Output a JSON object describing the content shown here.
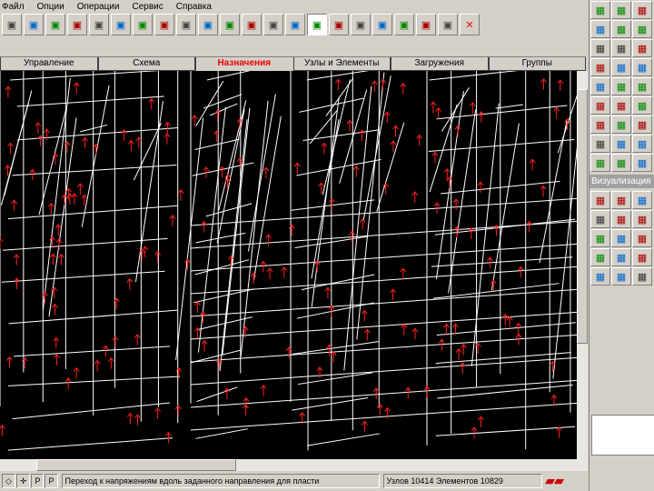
{
  "menu": [
    "Файл",
    "Опции",
    "Операции",
    "Сервис",
    "Справка"
  ],
  "toolbar_icons": [
    "plate-icon",
    "wall-icon",
    "slab-icon",
    "section-icon",
    "support-icon",
    "hinge-icon",
    "node-icon",
    "bar-icon",
    "link-icon",
    "grid-icon",
    "rigid-icon",
    "nodes-icon",
    "local-axes-icon",
    "load-icon",
    "color-map-icon",
    "color-map2-icon",
    "transfer-icon",
    "table-icon",
    "curve-icon",
    "layer-icon",
    "check-icon",
    "delete-icon"
  ],
  "tabs": [
    {
      "label": "Управление"
    },
    {
      "label": "Схема"
    },
    {
      "label": "Назначения",
      "selected": true
    },
    {
      "label": "Узлы и Элементы"
    },
    {
      "label": "Загружения"
    },
    {
      "label": "Группы"
    }
  ],
  "side_icons_top": [
    "pencil-icon",
    "eraser-icon",
    "cube-icon",
    "query-icon",
    "query2-icon",
    "query3-icon",
    "query-t-icon",
    "query-r-icon",
    "beam-icon",
    "axes-icon",
    "axes2-icon",
    "axes3-icon",
    "frame-icon",
    "frame2-icon",
    "frame3-icon",
    "node-num-icon",
    "elem-num-icon",
    "hinge2-icon",
    "flag-icon",
    "weight-icon",
    "list-icon",
    "cut-icon",
    "scale-icon",
    "chart-icon",
    "coords-icon",
    "table2-icon",
    "grid2-icon"
  ],
  "vis_label": "Визуализация",
  "side_icons_bottom": [
    "spin-icon",
    "move-icon",
    "move2-icon",
    "box-icon",
    "box2-icon",
    "box3-icon",
    "frame4-icon",
    "cube2-icon",
    "menu-icon",
    "camera-icon",
    "light-icon",
    "ball-icon",
    "color-icon",
    "grid3-icon",
    "palette-icon"
  ],
  "status": {
    "modes": [
      "◇",
      "✛",
      "P",
      "P"
    ],
    "message": "Переход к напряжениям вдоль заданного направления для пласти",
    "counts": "Узлов 10414 Элементов 10829"
  },
  "colors": {
    "lines": "#ffffff",
    "arrows": "#ff2020",
    "active_tab": "#e00000"
  }
}
